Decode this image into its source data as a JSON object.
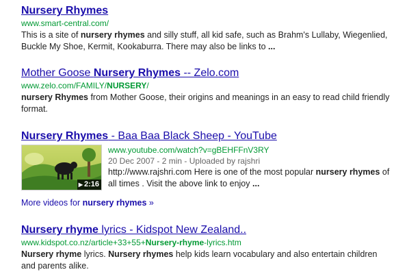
{
  "results": [
    {
      "title": [
        "Nursery Rhymes"
      ],
      "url": [
        "www.smart-central.com/"
      ],
      "snippet": [
        "This is a site of ",
        "nursery rhymes",
        " and silly stuff, all kid safe, such as Brahm's Lullaby, Wiegenlied, Buckle My Shoe, Kermit, Kookaburra. There may also be links to ",
        "..."
      ]
    },
    {
      "title": [
        "Mother Goose ",
        "Nursery Rhymes",
        " -- Zelo.com"
      ],
      "url": [
        "www.zelo.com/FAMILY/",
        "NURSERY",
        "/"
      ],
      "snippet": [
        "nursery",
        " ",
        "Rhymes",
        " from Mother Goose, their origins and meanings in an easy to read child friendly format."
      ]
    },
    {
      "title": [
        "Nursery Rhymes",
        " - Baa Baa Black Sheep - YouTube"
      ],
      "url": [
        "www.youtube.com/watch?v=gBEHFFnV3RY"
      ],
      "meta": "20 Dec 2007 - 2 min - Uploaded by rajshri",
      "duration": "2:16",
      "snippet": [
        "http://www.rajshri.com Here is one of the most popular ",
        "nursery rhymes",
        " of all times . Visit the above link to enjoy ",
        "..."
      ]
    },
    {
      "title": [
        "Nursery rhyme",
        " lyrics - Kidspot New Zealand.."
      ],
      "url": [
        "www.kidspot.co.nz/article+33+55+",
        "Nursery-rhyme",
        "-lyrics.htm"
      ],
      "snippet": [
        "Nursery",
        " ",
        "rhyme",
        " lyrics. ",
        "Nursery",
        " ",
        "rhymes",
        " help kids learn vocabulary and also entertain children and parents alike."
      ]
    }
  ],
  "more_videos": [
    "More videos for ",
    "nursery rhymes",
    " »"
  ],
  "icons": {
    "play": "play-icon"
  },
  "colors": {
    "link": "#1a0dab",
    "url": "#009933",
    "text": "#222222",
    "meta": "#666666"
  }
}
